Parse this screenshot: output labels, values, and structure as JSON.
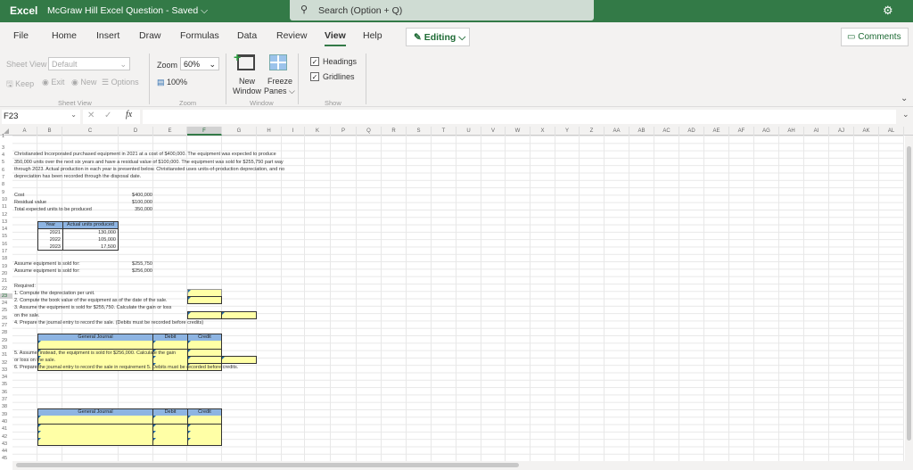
{
  "titlebar": {
    "app_name": "Excel",
    "doc_title": "McGraw Hill Excel Question  -  Saved  ⌵",
    "search_placeholder": "Search (Option + Q)"
  },
  "menu": {
    "items": [
      "File",
      "Home",
      "Insert",
      "Draw",
      "Formulas",
      "Data",
      "Review",
      "View",
      "Help"
    ],
    "active": "View",
    "editing_label": "Editing ⌵",
    "comments_label": "Comments"
  },
  "ribbon": {
    "sheet_view_label": "Sheet View",
    "sheet_view_value": "Default",
    "keep": "Keep",
    "exit": "Exit",
    "new": "New",
    "options": "Options",
    "group_sheet_view": "Sheet View",
    "zoom_label": "Zoom",
    "zoom_value": "60%",
    "zoom_100": "100%",
    "group_zoom": "Zoom",
    "new_window_1": "New",
    "new_window_2": "Window",
    "freeze_1": "Freeze",
    "freeze_2": "Panes ⌵",
    "group_window": "Window",
    "headings": "Headings",
    "gridlines": "Gridlines",
    "group_show": "Show"
  },
  "formula_bar": {
    "name_box": "F23",
    "fx": "fx",
    "value": ""
  },
  "columns": [
    "A",
    "B",
    "C",
    "D",
    "E",
    "F",
    "G",
    "H",
    "I",
    "K",
    "P",
    "Q",
    "R",
    "S",
    "T",
    "U",
    "V",
    "W",
    "X",
    "Y",
    "Z",
    "AA",
    "AB",
    "AC",
    "AD",
    "AE",
    "AF",
    "AG",
    "AH",
    "AI",
    "AJ",
    "AK",
    "AL"
  ],
  "selected_column": "F",
  "selected_row": "23",
  "rows": [
    "1",
    "3",
    "4",
    "5",
    "6",
    "7",
    "8",
    "9",
    "10",
    "11",
    "12",
    "13",
    "14",
    "15",
    "16",
    "17",
    "18",
    "19",
    "20",
    "21",
    "22",
    "23",
    "24",
    "25",
    "26",
    "27",
    "28",
    "29",
    "30",
    "31",
    "32",
    "33",
    "34",
    "35",
    "36",
    "37",
    "38",
    "39",
    "40",
    "41",
    "42",
    "43",
    "44",
    "45"
  ],
  "sheet": {
    "intro": [
      "Christiansted Incorporated purchased equipment in 2021 at a cost of $400,000. The equipment was expected to produce",
      "350,000 units over the next six years and have a residual value of $100,000. The equipment was sold for $255,750 part way",
      "through 2023. Actual production in each year is presented below. Christiansted uses units-of-production depreciation, and no",
      "depreciation has been recorded through the disposal date."
    ],
    "cost_label": "Cost",
    "cost_value": "$400,000",
    "residual_label": "Residual value",
    "residual_value": "$100,000",
    "units_label": "Total expected units to be produced",
    "units_value": "350,000",
    "prod_table": {
      "headers": [
        "Year",
        "Actual units produced"
      ],
      "rows": [
        [
          "2021",
          "130,000"
        ],
        [
          "2022",
          "105,000"
        ],
        [
          "2023",
          "17,500"
        ]
      ]
    },
    "sold1_label": "Assume equipment is sold for:",
    "sold1_value": "$255,750",
    "sold2_label": "Assume equipment is sold for:",
    "sold2_value": "$256,000",
    "required": "Required:",
    "q1": "1. Compute the depreciation per unit.",
    "q2": "2. Compute the book value of the equipment as of the date of the sale.",
    "q3a": "3. Assume the equipment is sold for $255,750.  Calculate the gain or loss",
    "q3b": "on the sale.",
    "q4": "4. Prepare the journal entry to record the sale.  (Debits must be recorded before credits)",
    "q5a": "5. Assume, instead, the equipment is sold for $256,000.  Calculate the gain",
    "q5b": "or loss on the sale.",
    "q6": "6. Prepare the journal entry to record the sale in requirement 5. Debits must be recorded before credits.",
    "journal_headers": [
      "General Journal",
      "Debit",
      "Credit"
    ]
  }
}
